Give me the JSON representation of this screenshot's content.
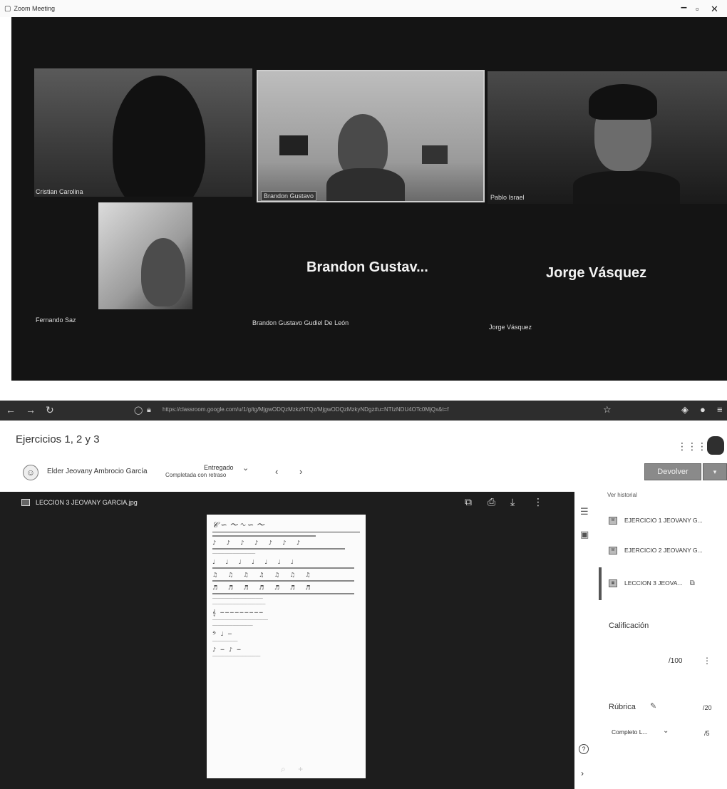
{
  "zoom": {
    "window_title": "Zoom Meeting",
    "participants": [
      {
        "name": "Cristian Carolina",
        "kind": "video"
      },
      {
        "name": "Brandon Gustavo",
        "kind": "video"
      },
      {
        "name": "Pablo Israel",
        "kind": "video"
      },
      {
        "name": "Fernando Saz",
        "kind": "video"
      },
      {
        "name": "Brandon Gustav...",
        "full_name": "Brandon Gustavo Gudiel De León",
        "kind": "name-only"
      },
      {
        "name": "Jorge Vásquez",
        "full_name": "Jorge Vásquez",
        "kind": "name-only"
      }
    ]
  },
  "browser": {
    "url": "https://classroom.google.com/u/1/g/tg/MjgwODQzMzkzNTQz/MjgwODQzMzkyNDgz#u=NTIzNDU4OTc0MjQx&t=f"
  },
  "classroom": {
    "page_title": "Ejercicios 1, 2 y 3",
    "student_name": "Elder Jeovany Ambrocio García",
    "status": "Entregado",
    "status_detail": "Completada con retraso",
    "return_button": "Devolver",
    "viewer_file": "LECCION 3 JEOVANY GARCIA.jpg",
    "history_link": "Ver historial",
    "attachments": [
      {
        "name": "EJERCICIO 1 JEOVANY G..."
      },
      {
        "name": "EJERCICIO 2 JEOVANY G..."
      },
      {
        "name": "LECCION 3 JEOVA..."
      }
    ],
    "grade_label": "Calificación",
    "grade_value": "/100",
    "rubric_label": "Rúbrica",
    "rubric_total": "/20",
    "criterion_label": "Completo L...",
    "criterion_score": "/5"
  },
  "icons": {
    "accent": "#8a8a8a",
    "viewer_bg": "#1d1d1d",
    "zoom_bg": "#141414"
  }
}
